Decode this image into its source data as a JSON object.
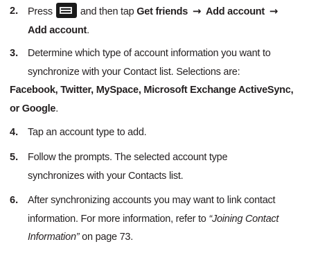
{
  "steps": [
    {
      "number": "2.",
      "press": "Press",
      "icon": "menu-icon",
      "then_tap": "and then tap",
      "path1": "Get friends",
      "arrow": "→",
      "path2": "Add account",
      "path3": "Add account",
      "period": "."
    },
    {
      "number": "3.",
      "line1": "Determine which type of account information you want to",
      "line2": "synchronize with your Contact list. Selections are:",
      "selections_line1": "Facebook, Twitter, MySpace, Microsoft Exchange ActiveSync,",
      "selections_line2": "or Google",
      "period": "."
    },
    {
      "number": "4.",
      "line1": "Tap an account type to add."
    },
    {
      "number": "5.",
      "line1": "Follow the prompts. The selected account type",
      "line2": "synchronizes with your Contacts list."
    },
    {
      "number": "6.",
      "line1": "After synchronizing accounts you may want to link contact",
      "line2_prefix": "information. For more information, refer to",
      "reference_part1": "“Joining Contact",
      "reference_part2": "Information”",
      "page_ref": "on page 73."
    }
  ]
}
